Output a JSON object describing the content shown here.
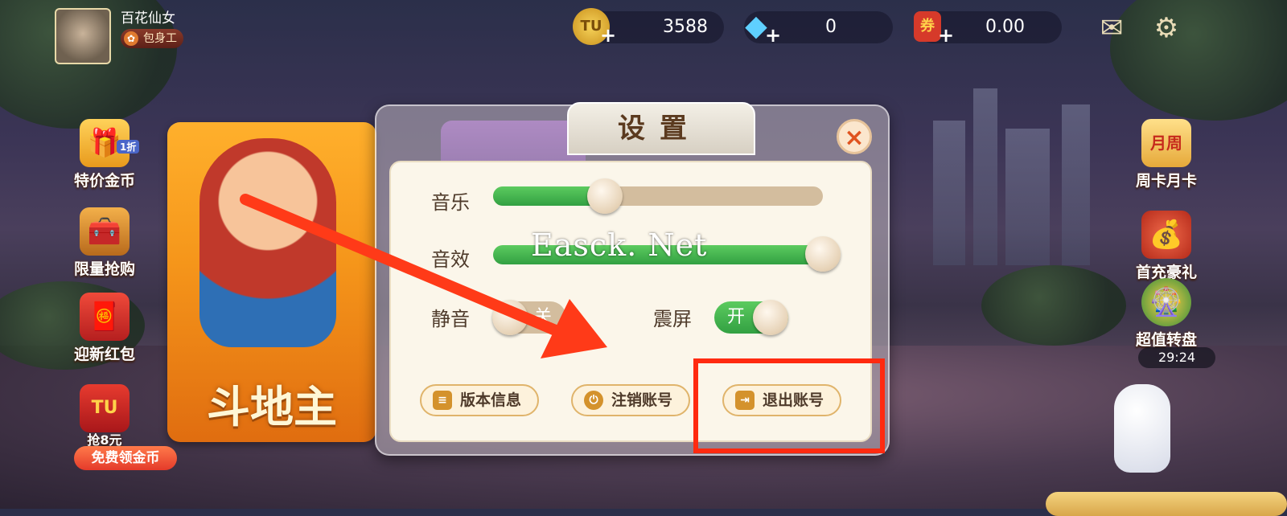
{
  "user": {
    "nickname": "百花仙女",
    "title_badge": "包身工",
    "badge_icon": "ribbon-icon"
  },
  "resources": [
    {
      "name": "gold-coin",
      "value": "3588",
      "icon_text": "TU",
      "color": "#e3b230"
    },
    {
      "name": "diamond",
      "value": "0",
      "icon_text": "◆",
      "color": "#35a9e6"
    },
    {
      "name": "voucher",
      "value": "0.00",
      "icon_text": "券",
      "color": "#d63a2a"
    }
  ],
  "top_icons": {
    "mail": "✉",
    "settings": "⚙"
  },
  "left_menu": [
    {
      "label": "特价金币",
      "tag": "1折",
      "icon": "🎁"
    },
    {
      "label": "限量抢购",
      "icon": "🧰"
    },
    {
      "label": "迎新红包",
      "icon": "🧧"
    },
    {
      "label": "抢8元",
      "icon": "TU"
    }
  ],
  "free_coins": "免费领金币",
  "right_menu": [
    {
      "label": "周卡月卡",
      "icon": "月周"
    },
    {
      "label": "首充豪礼",
      "icon": "💰"
    },
    {
      "label": "超值转盘",
      "icon": "🎡"
    }
  ],
  "wheel_timer": "29:24",
  "game_card": {
    "title": "斗地主"
  },
  "settings_dialog": {
    "title": "设置",
    "close_icon": "×",
    "music": {
      "label": "音乐",
      "level": 0.34
    },
    "sound_effects": {
      "label": "音效",
      "level": 1.0
    },
    "mute": {
      "label": "静音",
      "state_text": "关",
      "on": false
    },
    "screen_shake": {
      "label": "震屏",
      "state_text": "开",
      "on": true
    },
    "buttons": [
      {
        "label": "版本信息",
        "icon": "≡"
      },
      {
        "label": "注销账号",
        "icon": "⏻"
      },
      {
        "label": "退出账号",
        "icon": "⇥"
      }
    ]
  },
  "watermark": "Easck. Net",
  "annotation": {
    "arrow_color": "#ff3a18",
    "box_color": "#ff2a10"
  }
}
